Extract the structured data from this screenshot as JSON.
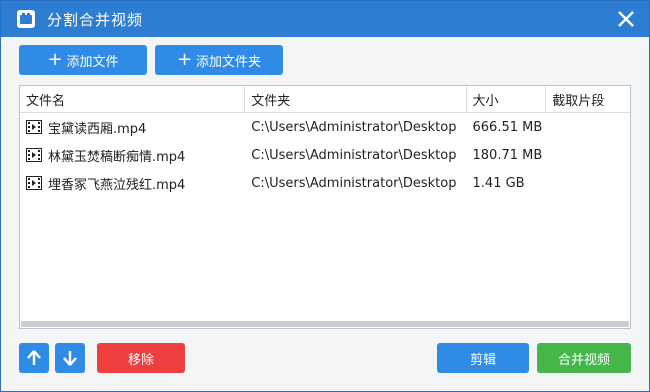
{
  "window": {
    "title": "分割合并视频"
  },
  "toolbar": {
    "add_file_label": "添加文件",
    "add_folder_label": "添加文件夹"
  },
  "table": {
    "columns": [
      "文件名",
      "文件夹",
      "大小",
      "截取片段"
    ],
    "rows": [
      {
        "name": "宝黛读西厢.mp4",
        "folder": "C:\\Users\\Administrator\\Desktop",
        "size": "666.51 MB",
        "segment": ""
      },
      {
        "name": "林黛玉焚稿断痴情.mp4",
        "folder": "C:\\Users\\Administrator\\Desktop",
        "size": "180.71 MB",
        "segment": ""
      },
      {
        "name": "埋香冢飞燕泣残红.mp4",
        "folder": "C:\\Users\\Administrator\\Desktop",
        "size": "1.41 GB",
        "segment": ""
      }
    ]
  },
  "actions": {
    "up_icon": "arrow-up-icon",
    "down_icon": "arrow-down-icon",
    "remove_label": "移除",
    "edit_label": "剪辑",
    "merge_label": "合并视频"
  },
  "colors": {
    "titlebar": "#2d7dd2",
    "primary": "#2f8be6",
    "danger": "#ef3e3e",
    "success": "#45b649"
  }
}
